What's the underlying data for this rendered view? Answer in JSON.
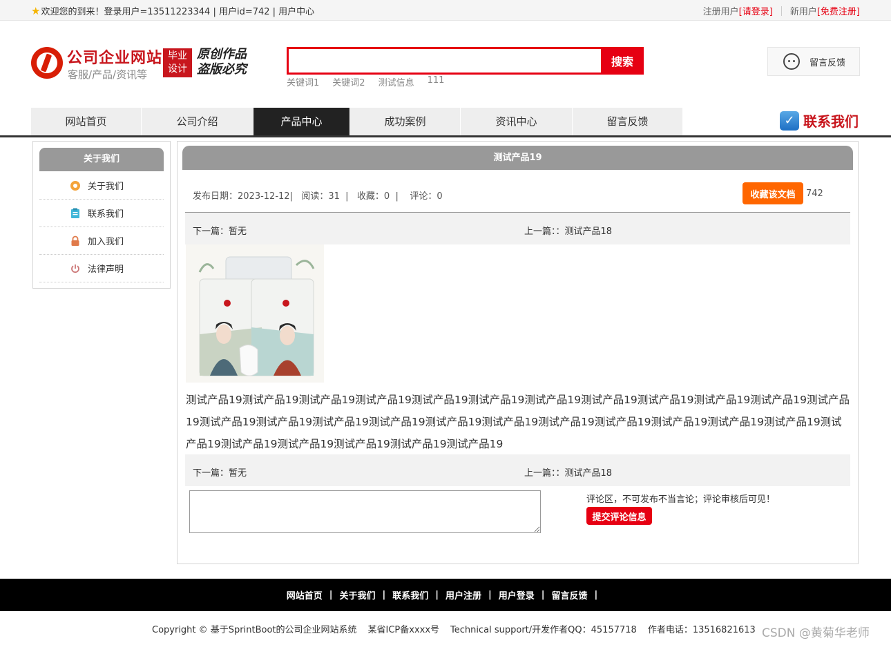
{
  "topbar": {
    "welcome": "欢迎您的到来！登录用户=13511223344 | 用户id=742 | 用户中心",
    "register_label": "注册用户",
    "login_link": "[请登录]",
    "new_user_label": "新用户",
    "signup_link": "[免费注册]"
  },
  "header": {
    "logo_title": "公司企业网站",
    "logo_sub": "客服/产品/资讯等",
    "badge_line1": "毕业",
    "badge_line2": "设计",
    "slogan_line1": "原创作品",
    "slogan_line2": "盗版必究",
    "search_placeholder": "",
    "search_button": "搜索",
    "keywords": [
      "关键词1",
      "关键词2",
      "测试信息",
      "111"
    ],
    "feedback_label": "留言反馈"
  },
  "nav": {
    "items": [
      "网站首页",
      "公司介绍",
      "产品中心",
      "成功案例",
      "资讯中心",
      "留言反馈"
    ],
    "active": "产品中心",
    "contact_label": "联系我们"
  },
  "sidebar": {
    "title": "关于我们",
    "items": [
      "关于我们",
      "联系我们",
      "加入我们",
      "法律声明"
    ]
  },
  "article": {
    "title": "测试产品19",
    "meta": "发布日期：2023-12-12|   阅读：31  |   收藏：0  |    评论：0",
    "favorite_button": "收藏该文档",
    "favorite_count": "742",
    "next_label": "下一篇：暂无",
    "prev_label": "上一篇：：测试产品18",
    "content": "测试产品19测试产品19测试产品19测试产品19测试产品19测试产品19测试产品19测试产品19测试产品19测试产品19测试产品19测试产品19测试产品19测试产品19测试产品19测试产品19测试产品19测试产品19测试产品19测试产品19测试产品19测试产品19测试产品19测试产品19测试产品19测试产品19测试产品19测试产品19测试产品19",
    "comment_tip": "评论区，不可发布不当言论；评论审核后可见！",
    "comment_button": "提交评论信息"
  },
  "footer": {
    "links": [
      "网站首页",
      "关于我们",
      "联系我们",
      "用户注册",
      "用户登录",
      "留言反馈"
    ],
    "copyright": "Copyright © 基于SprintBoot的公司企业网站系统",
    "icp": "某省ICP备xxxx号",
    "support": "Technical support/开发作者QQ：45157718",
    "phone": "作者电话：13516821613"
  },
  "watermark": "CSDN @黄菊华老师"
}
